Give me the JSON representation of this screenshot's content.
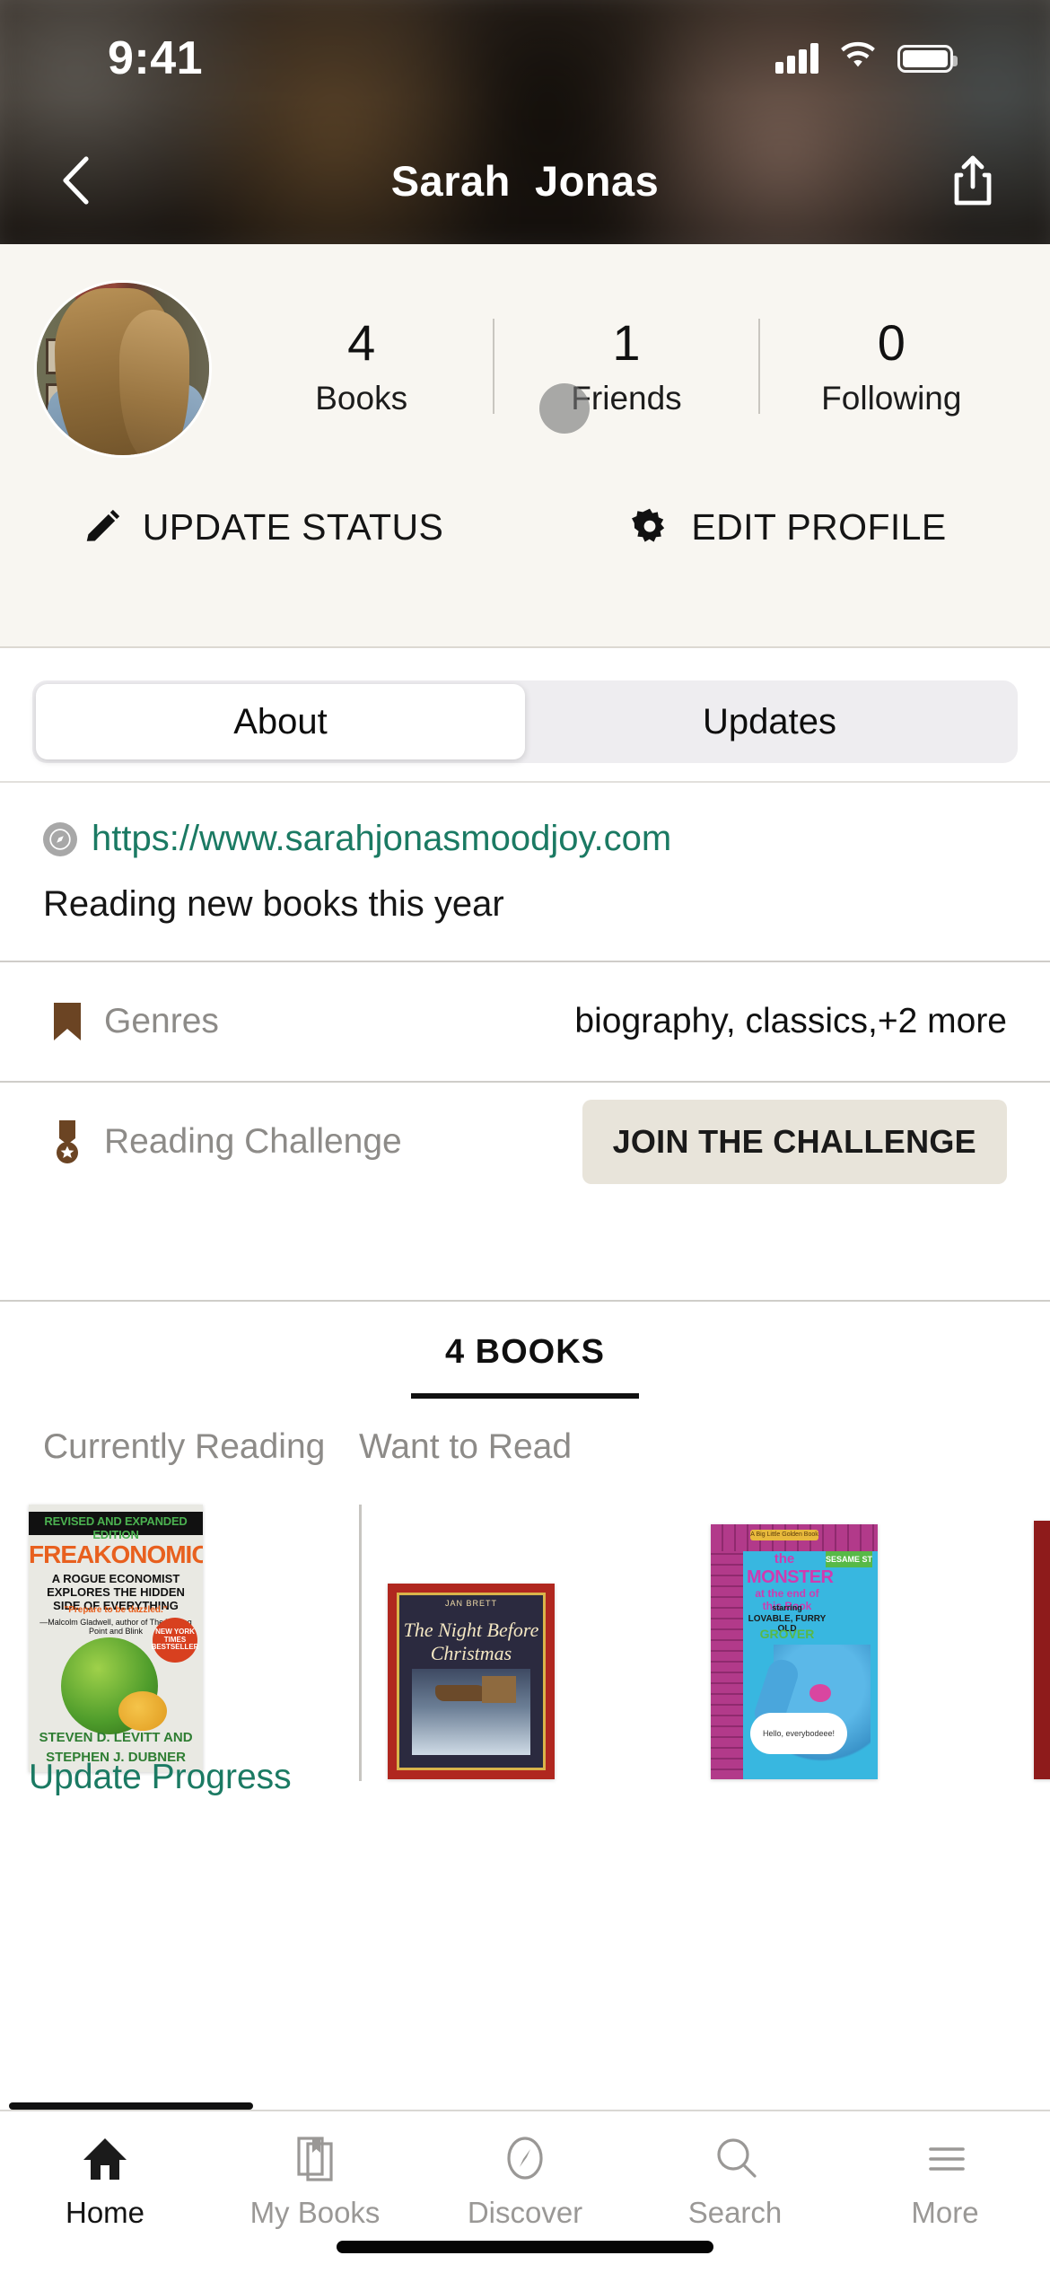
{
  "status_bar": {
    "time": "9:41",
    "signal_icon": "cellular-signal-icon",
    "wifi_icon": "wifi-icon",
    "battery_icon": "battery-icon"
  },
  "nav": {
    "back_icon": "chevron-left-icon",
    "title": "Sarah  Jonas",
    "share_icon": "share-icon"
  },
  "profile": {
    "avatar_alt": "avatar",
    "stats": [
      {
        "value": "4",
        "label": "Books"
      },
      {
        "value": "1",
        "label": "Friends"
      },
      {
        "value": "0",
        "label": "Following"
      }
    ],
    "actions": [
      {
        "icon": "pencil-icon",
        "label": "UPDATE STATUS"
      },
      {
        "icon": "gear-icon",
        "label": "EDIT PROFILE"
      }
    ]
  },
  "segmented": {
    "items": [
      {
        "label": "About",
        "selected": true
      },
      {
        "label": "Updates",
        "selected": false
      }
    ]
  },
  "about": {
    "link_icon": "compass-icon",
    "website": "https://www.sarahjonasmoodjoy.com",
    "bio": "Reading new books this year",
    "rows": [
      {
        "icon": "bookmark-icon",
        "label": "Genres",
        "value": "biography, classics,+2 more"
      },
      {
        "icon": "medal-icon",
        "label": "Reading Challenge",
        "button": "JOIN THE CHALLENGE"
      }
    ]
  },
  "books_section": {
    "tab_label": "4 BOOKS",
    "shelves": [
      {
        "title": "Currently Reading"
      },
      {
        "title": "Want to Read"
      }
    ],
    "update_progress_label": "Update Progress",
    "covers": {
      "freakonomics": {
        "band": "REVISED AND EXPANDED EDITION",
        "title": "FREAKONOMICS",
        "subtitle": "A ROGUE ECONOMIST EXPLORES THE HIDDEN SIDE OF EVERYTHING",
        "quote": "\"Prepare to be dazzled.\"",
        "quote_source": "—Malcolm Gladwell, author of The Tipping Point and Blink",
        "seal": "NEW YORK TIMES BESTSELLER",
        "author_line1": "STEVEN D. LEVITT AND",
        "author_line2": "STEPHEN J. DUBNER"
      },
      "night_before_christmas": {
        "author": "JAN BRETT",
        "title_line1": "The Night Before",
        "title_line2": "Christmas"
      },
      "monster_end_book": {
        "banner": "A Big Little Golden Book",
        "badge": "SESAME ST",
        "title_line1": "the",
        "title_line2": "MONSTER",
        "title_line3": "at the end of this Book",
        "starring": "starring",
        "character_line": "LOVABLE, FURRY OLD",
        "character": "GROVER",
        "bubble": "Hello, everybodeee!"
      }
    }
  },
  "tabbar": {
    "items": [
      {
        "icon": "home-icon",
        "label": "Home",
        "active": true
      },
      {
        "icon": "books-icon",
        "label": "My Books",
        "active": false
      },
      {
        "icon": "compass-icon",
        "label": "Discover",
        "active": false
      },
      {
        "icon": "search-icon",
        "label": "Search",
        "active": false
      },
      {
        "icon": "menu-icon",
        "label": "More",
        "active": false
      }
    ]
  },
  "colors": {
    "link": "#1b7a63",
    "profile_bg": "#f8f6f1",
    "button_bg": "#e8e4da",
    "accent_dark": "#111111"
  }
}
